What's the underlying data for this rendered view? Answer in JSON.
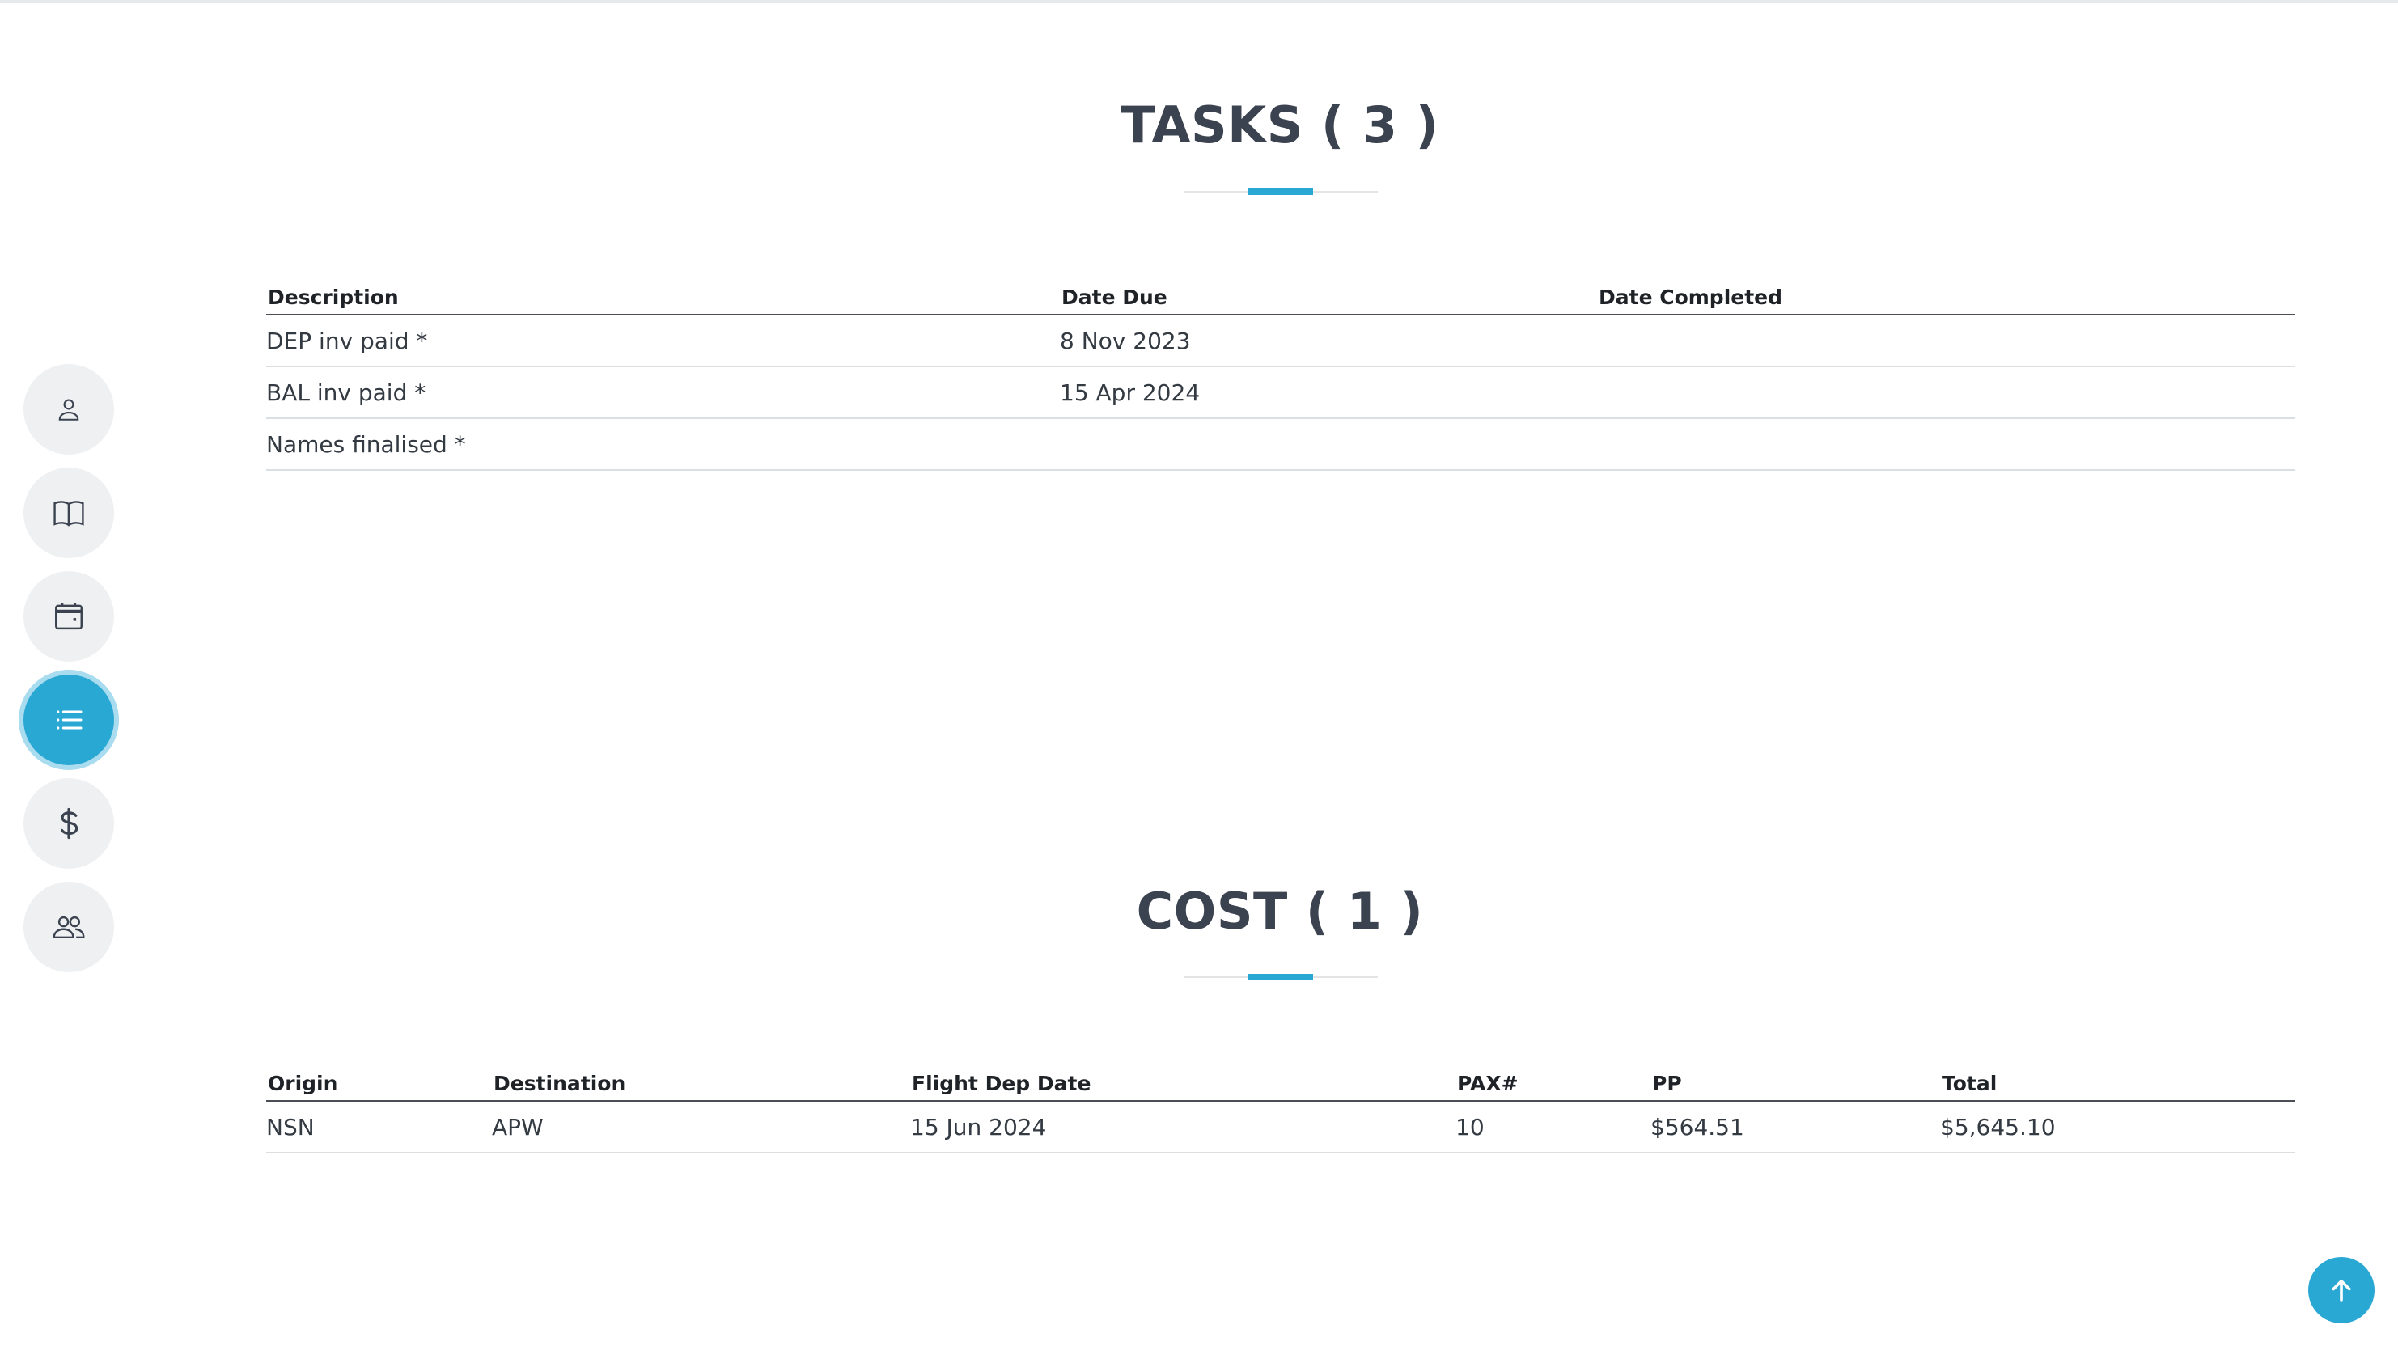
{
  "tasks": {
    "title": "TASKS ( 3 )",
    "columns": [
      "Description",
      "Date Due",
      "Date Completed"
    ],
    "rows": [
      [
        "DEP inv paid *",
        "8 Nov 2023",
        ""
      ],
      [
        "BAL inv paid *",
        "15 Apr 2024",
        ""
      ],
      [
        "Names finalised *",
        "",
        ""
      ]
    ]
  },
  "cost": {
    "title": "COST ( 1 )",
    "columns": [
      "Origin",
      "Destination",
      "Flight Dep Date",
      "PAX#",
      "PP",
      "Total"
    ],
    "rows": [
      [
        "NSN",
        "APW",
        "15 Jun 2024",
        "10",
        "$564.51",
        "$5,645.10"
      ]
    ]
  },
  "side_nav": [
    {
      "icon": "person-icon",
      "active": false
    },
    {
      "icon": "book-icon",
      "active": false
    },
    {
      "icon": "calendar-icon",
      "active": false
    },
    {
      "icon": "list-icon",
      "active": true
    },
    {
      "icon": "dollar-icon",
      "active": false
    },
    {
      "icon": "group-icon",
      "active": false
    }
  ],
  "colors": {
    "accent": "#2aa8d4",
    "title": "#3b4350",
    "nav_bg": "#eff0f1"
  }
}
